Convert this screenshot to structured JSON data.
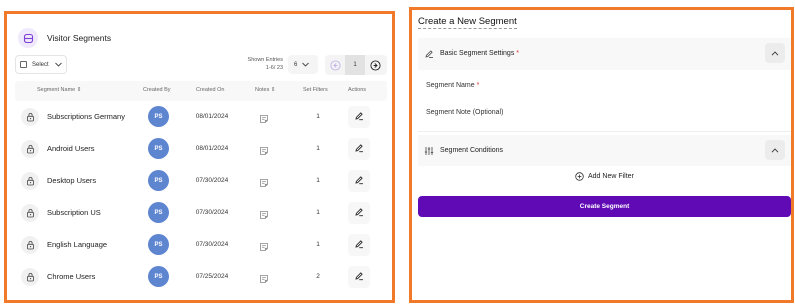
{
  "left_panel": {
    "title": "Visitor Segments",
    "select_label": "Select",
    "entries_label": "Shown Entries",
    "entries_range": "1-6/ 23",
    "rows_per_page": "6",
    "current_page": "1",
    "columns": {
      "name": "Segment Name",
      "created_by": "Created By",
      "created_on": "Created On",
      "notes": "Notes",
      "filters": "Set Filters",
      "actions": "Actions"
    },
    "rows": [
      {
        "name": "Subscriptions Germany",
        "initials": "PS",
        "date": "08/01/2024",
        "filters": "1"
      },
      {
        "name": "Android Users",
        "initials": "PS",
        "date": "08/01/2024",
        "filters": "1"
      },
      {
        "name": "Desktop Users",
        "initials": "PS",
        "date": "07/30/2024",
        "filters": "1"
      },
      {
        "name": "Subscription US",
        "initials": "PS",
        "date": "07/30/2024",
        "filters": "1"
      },
      {
        "name": "English Language",
        "initials": "PS",
        "date": "07/30/2024",
        "filters": "1"
      },
      {
        "name": "Chrome Users",
        "initials": "PS",
        "date": "07/25/2024",
        "filters": "2"
      }
    ]
  },
  "right_panel": {
    "title": "Create a New Segment",
    "basic_settings_label": "Basic Segment Settings",
    "required_mark": "*",
    "segment_name_label": "Segment Name",
    "segment_note_label": "Segment Note (Optional)",
    "conditions_label": "Segment Conditions",
    "add_filter_label": "Add New Filter",
    "create_button_label": "Create Segment"
  },
  "colors": {
    "accent": "#5f0ab5",
    "avatar": "#5e85cf",
    "highlight_border": "#f07a2a",
    "required": "#d0342c"
  },
  "icons": {
    "header": "segments-icon",
    "row": "lock-icon",
    "notes": "note-icon",
    "edit": "pencil-icon",
    "settings": "pencil-icon",
    "conditions": "sliders-icon",
    "collapse": "chevron-up-icon",
    "add": "plus-circle-icon",
    "prev": "arrow-left-icon",
    "next": "arrow-right-icon"
  }
}
